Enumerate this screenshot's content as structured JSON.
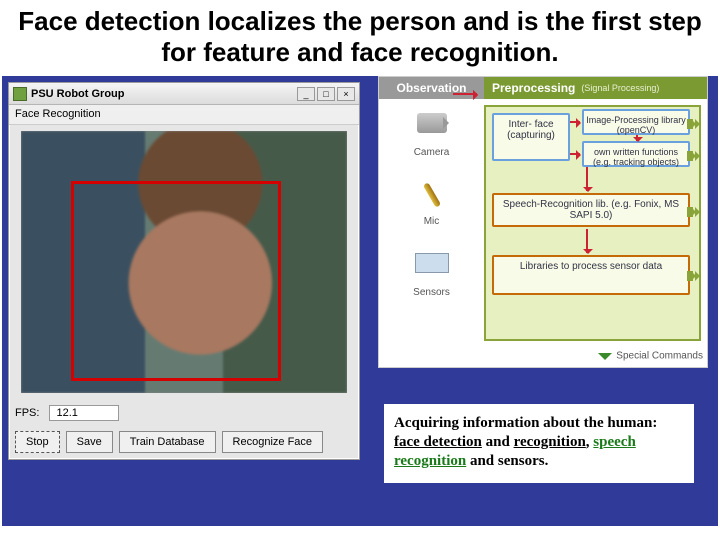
{
  "title": "Face detection localizes the person and is the first step for feature and face recognition.",
  "app": {
    "window_title": "PSU  Robot Group",
    "section_label": "Face Recognition",
    "win_buttons": {
      "min": "_",
      "max": "□",
      "close": "×"
    },
    "fps_label": "FPS:",
    "fps_value": "12.1",
    "buttons": {
      "stop": "Stop",
      "save": "Save",
      "train": "Train Database",
      "recognize": "Recognize Face"
    }
  },
  "diagram": {
    "observation_header": "Observation",
    "preprocessing_header": "Preprocessing",
    "preprocessing_sub": "(Signal Processing)",
    "obs": {
      "camera": "Camera",
      "mic": "Mic",
      "sensors": "Sensors"
    },
    "boxes": {
      "interface": "Inter-\nface\n(capturing)",
      "img_lib": "Image-Processing library (openCV)",
      "own_funcs": "own written functions (e.g. tracking objects)",
      "speech": "Speech-Recognition lib. (e.g. Fonix, MS SAPI 5.0)",
      "sensor_lib": "Libraries to process sensor data"
    },
    "special_commands": "Special Commands"
  },
  "caption": {
    "lead": "Acquiring information about the human: ",
    "face": "face detection",
    "mid1": " and ",
    "recog": "recognition",
    "mid2": ", ",
    "speech": "speech recognition",
    "tail": " and sensors."
  }
}
